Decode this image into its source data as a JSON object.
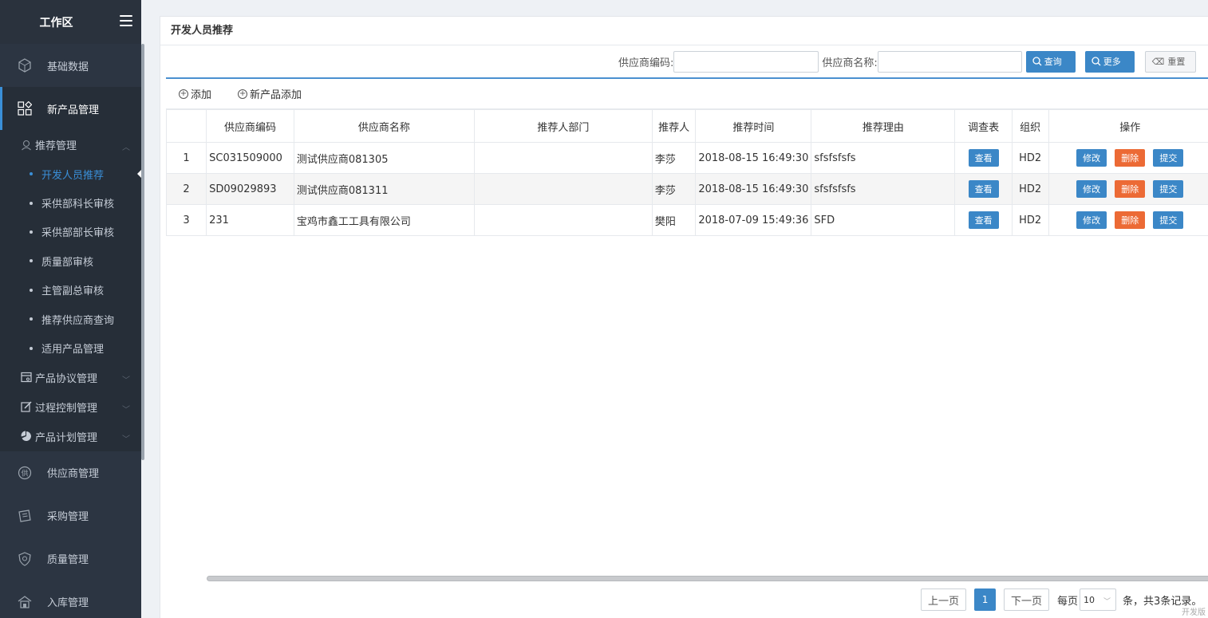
{
  "sidebar": {
    "title": "工作区",
    "top_items": [
      {
        "label": "基础数据",
        "icon": "cube-icon"
      }
    ],
    "active_group": {
      "label": "新产品管理",
      "icon": "apps-icon"
    },
    "subgroups": [
      {
        "label": "推荐管理",
        "icon": "user-icon"
      }
    ],
    "leaves": [
      {
        "label": "开发人员推荐",
        "active": true
      },
      {
        "label": "采供部科长审核"
      },
      {
        "label": "采供部部长审核"
      },
      {
        "label": "质量部审核"
      },
      {
        "label": "主管副总审核"
      },
      {
        "label": "推荐供应商查询"
      },
      {
        "label": "适用产品管理"
      }
    ],
    "more_subgroups": [
      {
        "label": "产品协议管理",
        "icon": "contract-icon"
      },
      {
        "label": "过程控制管理",
        "icon": "edit-icon"
      },
      {
        "label": "产品计划管理",
        "icon": "pie-icon"
      }
    ],
    "bottom_items": [
      {
        "label": "供应商管理",
        "icon": "supplier-icon"
      },
      {
        "label": "采购管理",
        "icon": "purchase-icon"
      },
      {
        "label": "质量管理",
        "icon": "shield-icon"
      },
      {
        "label": "入库管理",
        "icon": "warehouse-icon"
      }
    ]
  },
  "page": {
    "title": "开发人员推荐",
    "search": {
      "code_label": "供应商编码:",
      "code_value": "",
      "name_label": "供应商名称:",
      "name_value": "",
      "query_label": "查询",
      "more_label": "更多",
      "reset_label": "重置"
    },
    "toolbar": {
      "add_label": "添加",
      "add_product_label": "新产品添加"
    },
    "table": {
      "headers": [
        "",
        "供应商编码",
        "供应商名称",
        "推荐人部门",
        "推荐人",
        "推荐时间",
        "推荐理由",
        "调查表",
        "组织",
        "操作"
      ],
      "rows": [
        {
          "index": "1",
          "code": "SC031509000",
          "name": "测试供应商081305",
          "dept": "",
          "person": "李莎",
          "time": "2018-08-15 16:49:30",
          "reason": "sfsfsfsfs",
          "survey": "查看",
          "org": "HD2"
        },
        {
          "index": "2",
          "code": "SD09029893",
          "name": "测试供应商081311",
          "dept": "",
          "person": "李莎",
          "time": "2018-08-15 16:49:30",
          "reason": "sfsfsfsfs",
          "survey": "查看",
          "org": "HD2"
        },
        {
          "index": "3",
          "code": "231",
          "name": "宝鸡市鑫工工具有限公司",
          "dept": "",
          "person": "樊阳",
          "time": "2018-07-09 15:49:36",
          "reason": "SFD",
          "survey": "查看",
          "org": "HD2"
        }
      ],
      "actions": {
        "edit": "修改",
        "delete": "删除",
        "submit": "提交"
      }
    },
    "pager": {
      "prev": "上一页",
      "current": "1",
      "next": "下一页",
      "per_page_label": "每页",
      "per_page_value": "10",
      "summary": "条，共3条记录。"
    },
    "watermark": "开发版"
  }
}
